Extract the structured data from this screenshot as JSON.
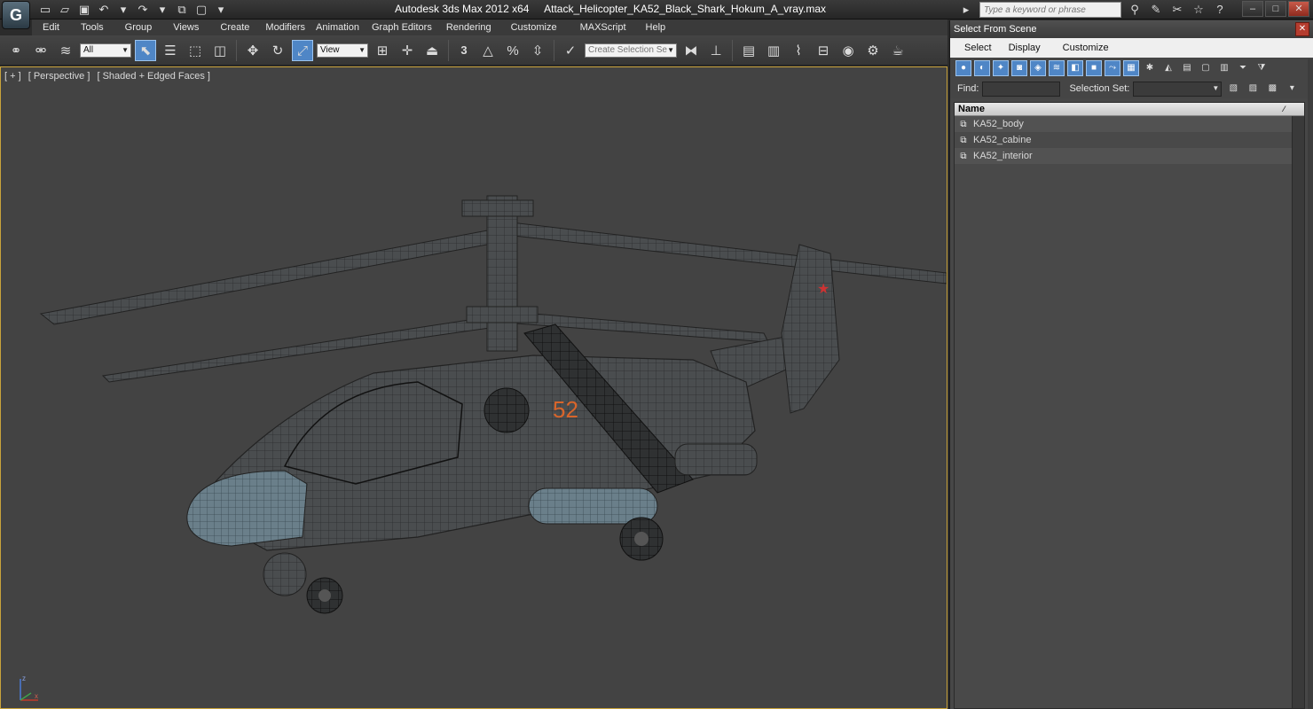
{
  "app": {
    "logo_glyph": "G",
    "title_product": "Autodesk 3ds Max  2012 x64",
    "title_file": "Attack_Helicopter_KA52_Black_Shark_Hokum_A_vray.max",
    "search_placeholder": "Type a keyword or phrase"
  },
  "menu": [
    "Edit",
    "Tools",
    "Group",
    "Views",
    "Create",
    "Modifiers",
    "Animation",
    "Graph Editors",
    "Rendering",
    "Customize",
    "MAXScript",
    "Help"
  ],
  "toolbar": {
    "filter_value": "All",
    "ref_coord_value": "View",
    "selection_set_placeholder": "Create Selection Se",
    "snap_label": "3"
  },
  "viewport": {
    "label_parts": [
      "[ + ]",
      "[ Perspective ]",
      "[ Shaded + Edged Faces ]"
    ],
    "fuselage_number": "52",
    "axis_z": "z",
    "axis_x": "x"
  },
  "dialog": {
    "title": "Select From Scene",
    "close_glyph": "✕",
    "menu": [
      "Select",
      "Display",
      "Customize"
    ],
    "find_label": "Find:",
    "selection_set_label": "Selection Set:",
    "column_header": "Name",
    "objects": [
      "KA52_body",
      "KA52_cabine",
      "KA52_interior"
    ]
  },
  "colors": {
    "viewport_border": "#c9a33b",
    "active_button": "#4f86c6",
    "viewport_bg": "#434343"
  }
}
